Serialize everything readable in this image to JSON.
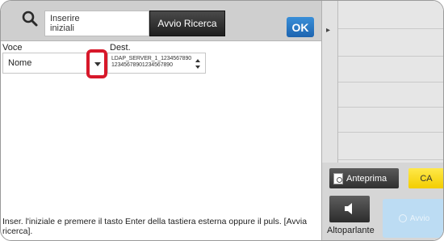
{
  "search": {
    "input_value": "Inserire\niniziali",
    "button_label": "Avvio Ricerca",
    "ok_label": "OK"
  },
  "form": {
    "voce_label": "Voce",
    "dest_label": "Dest.",
    "voce_value": "Nome",
    "dest_value": "LDAP_SERVER_1_1234567890\n12345678901234567890"
  },
  "info": {
    "text": "Inser. l'iniziale e premere il tasto Enter della tastiera esterna oppure il puls. [Avvia ricerca]."
  },
  "side": {
    "collapse_icon": "▸",
    "preview_label": "Anteprima",
    "ca_label": "CA",
    "speaker_label": "Altoparlante",
    "start_label": "Avvio"
  },
  "colors": {
    "ok_blue": "#1d64b0",
    "ca_yellow": "#f3cd00",
    "highlight_red": "#d7182a",
    "start_disabled": "#bcdcf3"
  }
}
